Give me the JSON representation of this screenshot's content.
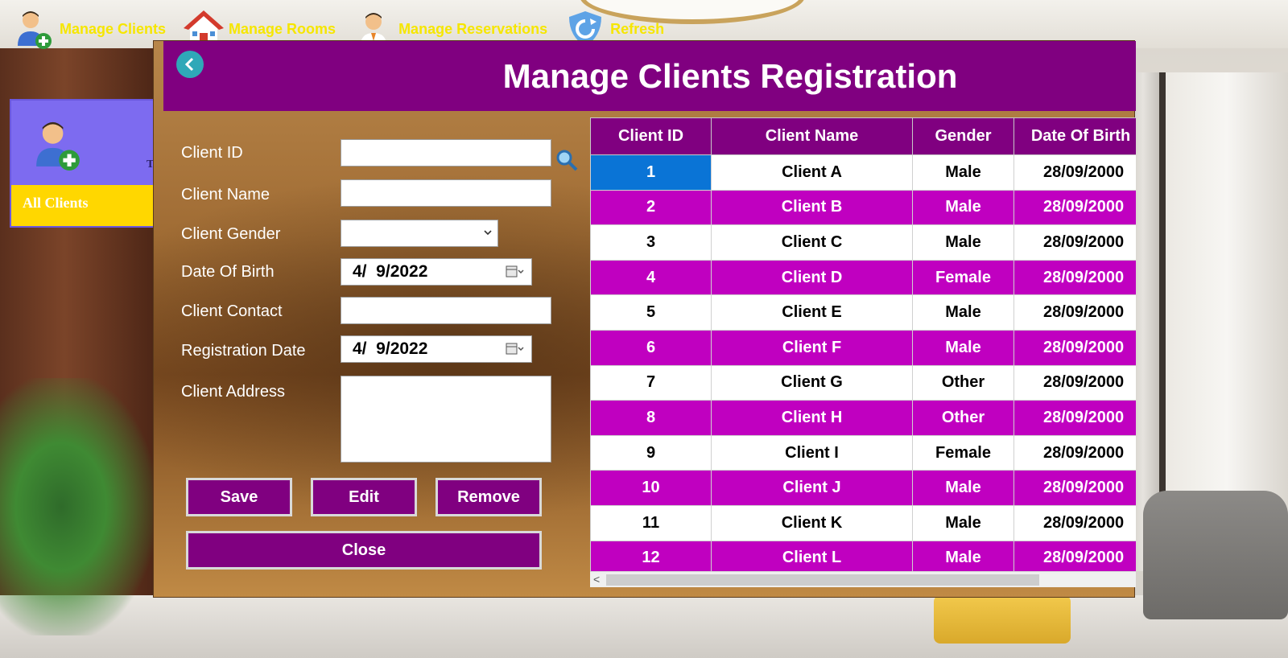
{
  "toolbar": {
    "items": [
      {
        "label": "Manage Clients",
        "icon": "add-user-icon"
      },
      {
        "label": "Manage Rooms",
        "icon": "house-icon"
      },
      {
        "label": "Manage Reservations",
        "icon": "receptionist-icon"
      },
      {
        "label": "Refresh",
        "icon": "refresh-shield-icon"
      }
    ],
    "label_color": "#f6e600"
  },
  "sidebar": {
    "card_icon": "add-user-icon",
    "clipped_letter": "T",
    "all_clients_label": "All Clients",
    "card_color": "#7d6bf0",
    "label_bg": "#ffd700"
  },
  "dialog": {
    "title": "Manage Clients Registration",
    "header_color": "#800080",
    "back_icon": "chevron-left-icon"
  },
  "form": {
    "client_id_label": "Client ID",
    "client_id_value": "",
    "client_name_label": "Client Name",
    "client_name_value": "",
    "client_gender_label": "Client Gender",
    "client_gender_value": "",
    "dob_label": "Date Of Birth",
    "dob_value": "4/  9/2022",
    "contact_label": "Client Contact",
    "contact_value": "",
    "reg_date_label": "Registration Date",
    "reg_date_value": "4/  9/2022",
    "address_label": "Client Address",
    "address_value": ""
  },
  "buttons": {
    "save": "Save",
    "edit": "Edit",
    "remove": "Remove",
    "close": "Close"
  },
  "grid": {
    "columns": [
      "Client ID",
      "Client Name",
      "Gender",
      "Date Of Birth"
    ],
    "selected_row": 0,
    "row_colors": {
      "odd": "#ffffff",
      "even": "#c000c0",
      "selected": "#0a74d6"
    },
    "rows": [
      {
        "id": "1",
        "name": "Client A",
        "gender": "Male",
        "dob": "28/09/2000"
      },
      {
        "id": "2",
        "name": "Client B",
        "gender": "Male",
        "dob": "28/09/2000"
      },
      {
        "id": "3",
        "name": "Client C",
        "gender": "Male",
        "dob": "28/09/2000"
      },
      {
        "id": "4",
        "name": "Client D",
        "gender": "Female",
        "dob": "28/09/2000"
      },
      {
        "id": "5",
        "name": "Client E",
        "gender": "Male",
        "dob": "28/09/2000"
      },
      {
        "id": "6",
        "name": "Client F",
        "gender": "Male",
        "dob": "28/09/2000"
      },
      {
        "id": "7",
        "name": "Client G",
        "gender": "Other",
        "dob": "28/09/2000"
      },
      {
        "id": "8",
        "name": "Client H",
        "gender": "Other",
        "dob": "28/09/2000"
      },
      {
        "id": "9",
        "name": "Client I",
        "gender": "Female",
        "dob": "28/09/2000"
      },
      {
        "id": "10",
        "name": "Client J",
        "gender": "Male",
        "dob": "28/09/2000"
      },
      {
        "id": "11",
        "name": "Client K",
        "gender": "Male",
        "dob": "28/09/2000"
      },
      {
        "id": "12",
        "name": "Client L",
        "gender": "Male",
        "dob": "28/09/2000"
      }
    ]
  }
}
